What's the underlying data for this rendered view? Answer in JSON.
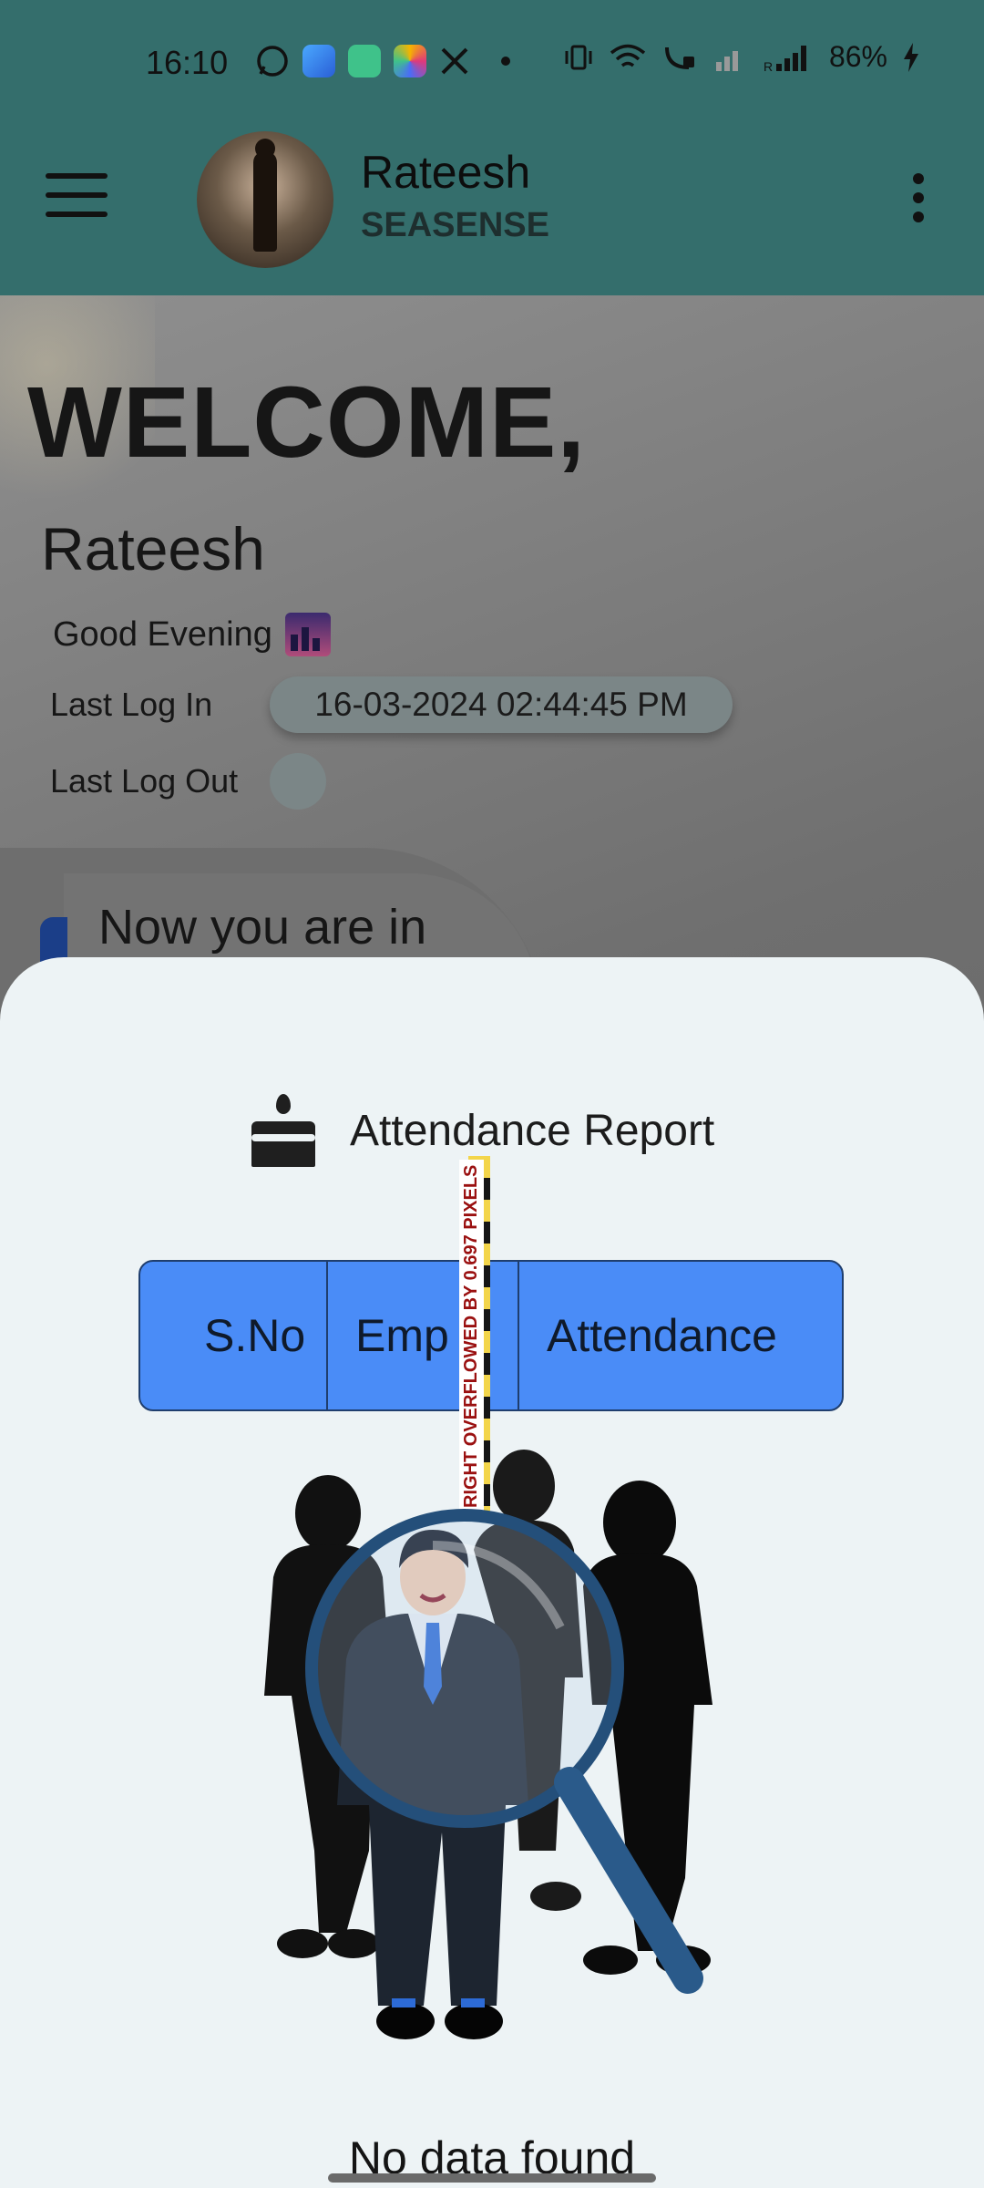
{
  "status_bar": {
    "time": "16:10",
    "battery": "86%"
  },
  "header": {
    "user_name": "Rateesh",
    "company": "SEASENSE"
  },
  "dashboard": {
    "welcome": "WELCOME,",
    "name": "Rateesh",
    "greeting": "Good Evening",
    "last_login_label": "Last Log In",
    "last_login_value": "16-03-2024  02:44:45 PM",
    "last_logout_label": "Last Log Out",
    "status_card_text": "Now you are in"
  },
  "sheet": {
    "title": "Attendance Report",
    "columns": [
      "S.No",
      "Emp I",
      "Attendance"
    ],
    "overflow_warning": "RIGHT OVERFLOWED BY 0.697 PIXELS",
    "empty_message": "No data found"
  },
  "colors": {
    "app_bar": "#346e6c",
    "table_header": "#4a8cf7",
    "sheet_bg": "#edf3f5"
  }
}
